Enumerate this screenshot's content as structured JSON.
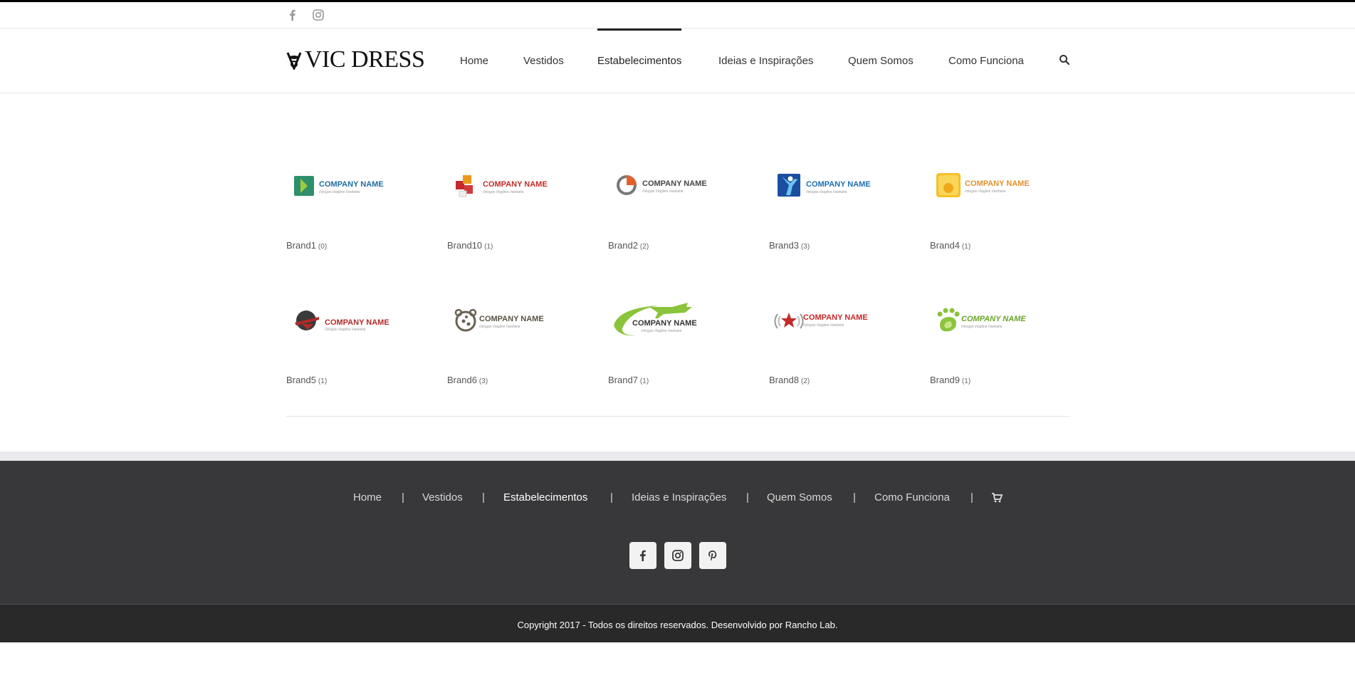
{
  "top_social": {
    "icons": [
      "facebook-icon",
      "instagram-icon"
    ]
  },
  "logo": {
    "text": "VIC DRESS"
  },
  "nav": {
    "items": [
      {
        "label": "Home"
      },
      {
        "label": "Vestidos"
      },
      {
        "label": "Estabelecimentos",
        "active": true
      },
      {
        "label": "Ideias e Inspirações"
      },
      {
        "label": "Quem Somos"
      },
      {
        "label": "Como Funciona"
      }
    ],
    "search_icon": "search-icon"
  },
  "brands": [
    {
      "name": "Brand1",
      "count": "(0)",
      "logo_title": "COMPANY NAME",
      "logo_tagline": "//slogan  //tagline  //website"
    },
    {
      "name": "Brand10",
      "count": "(1)",
      "logo_title": "COMPANY NAME",
      "logo_tagline": "//slogan  //tagline  //website"
    },
    {
      "name": "Brand2",
      "count": "(2)",
      "logo_title": "COMPANY NAME",
      "logo_tagline": "//slogan  //tagline  //website"
    },
    {
      "name": "Brand3",
      "count": "(3)",
      "logo_title": "COMPANY NAME",
      "logo_tagline": "//slogan  //tagline  //website"
    },
    {
      "name": "Brand4",
      "count": "(1)",
      "logo_title": "COMPANY NAME",
      "logo_tagline": "//slogan  //tagline  //website"
    },
    {
      "name": "Brand5",
      "count": "(1)",
      "logo_title": "COMPANY NAME",
      "logo_tagline": "//slogan  //tagline  //website"
    },
    {
      "name": "Brand6",
      "count": "(3)",
      "logo_title": "COMPANY NAME",
      "logo_tagline": "//slogan  //tagline  //website"
    },
    {
      "name": "Brand7",
      "count": "(1)",
      "logo_title": "COMPANY NAME",
      "logo_tagline": "//slogan  //tagline  //website"
    },
    {
      "name": "Brand8",
      "count": "(2)",
      "logo_title": "COMPANY NAME",
      "logo_tagline": "//slogan  //tagline  //website"
    },
    {
      "name": "Brand9",
      "count": "(1)",
      "logo_title": "COMPANY NAME",
      "logo_tagline": "//slogan  //tagline  //website"
    }
  ],
  "footer": {
    "nav": [
      {
        "label": "Home"
      },
      {
        "label": "Vestidos"
      },
      {
        "label": "Estabelecimentos",
        "active": true
      },
      {
        "label": "Ideias e Inspirações"
      },
      {
        "label": "Quem Somos"
      },
      {
        "label": "Como Funciona"
      }
    ],
    "separator": "|",
    "cart_icon": "cart-icon",
    "social_icons": [
      "facebook-icon",
      "instagram-icon",
      "pinterest-icon"
    ],
    "copyright": "Copyright 2017 - Todos os direitos reservados. Desenvolvido por Rancho Lab."
  },
  "colors": {
    "top_bar": "#000000",
    "footer_bg": "#38383a",
    "copyright_bg": "#292929",
    "footer_strip": "#e9e9ee"
  }
}
